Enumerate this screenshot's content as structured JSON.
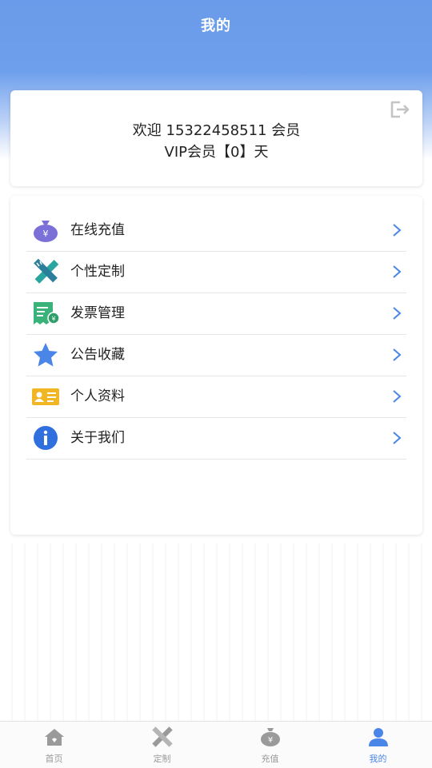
{
  "header": {
    "title": "我的"
  },
  "welcome": {
    "line1": "欢迎 15322458511 会员",
    "line2": "VIP会员【0】天"
  },
  "menu": {
    "items": [
      {
        "label": "在线充值",
        "icon": "money-bag-icon"
      },
      {
        "label": "个性定制",
        "icon": "ruler-pencil-icon"
      },
      {
        "label": "发票管理",
        "icon": "invoice-icon"
      },
      {
        "label": "公告收藏",
        "icon": "star-icon"
      },
      {
        "label": "个人资料",
        "icon": "id-card-icon"
      },
      {
        "label": "关于我们",
        "icon": "info-icon"
      }
    ]
  },
  "tabbar": {
    "tabs": [
      {
        "label": "首页",
        "icon": "home-icon",
        "active": false
      },
      {
        "label": "定制",
        "icon": "ruler-pencil-icon",
        "active": false
      },
      {
        "label": "充值",
        "icon": "money-bag-icon",
        "active": false
      },
      {
        "label": "我的",
        "icon": "user-icon",
        "active": true
      }
    ]
  },
  "colors": {
    "primary": "#6a9bea",
    "active_tab": "#4a86e8",
    "inactive_tab": "#9a9a9a",
    "chevron": "#4a86e8"
  }
}
